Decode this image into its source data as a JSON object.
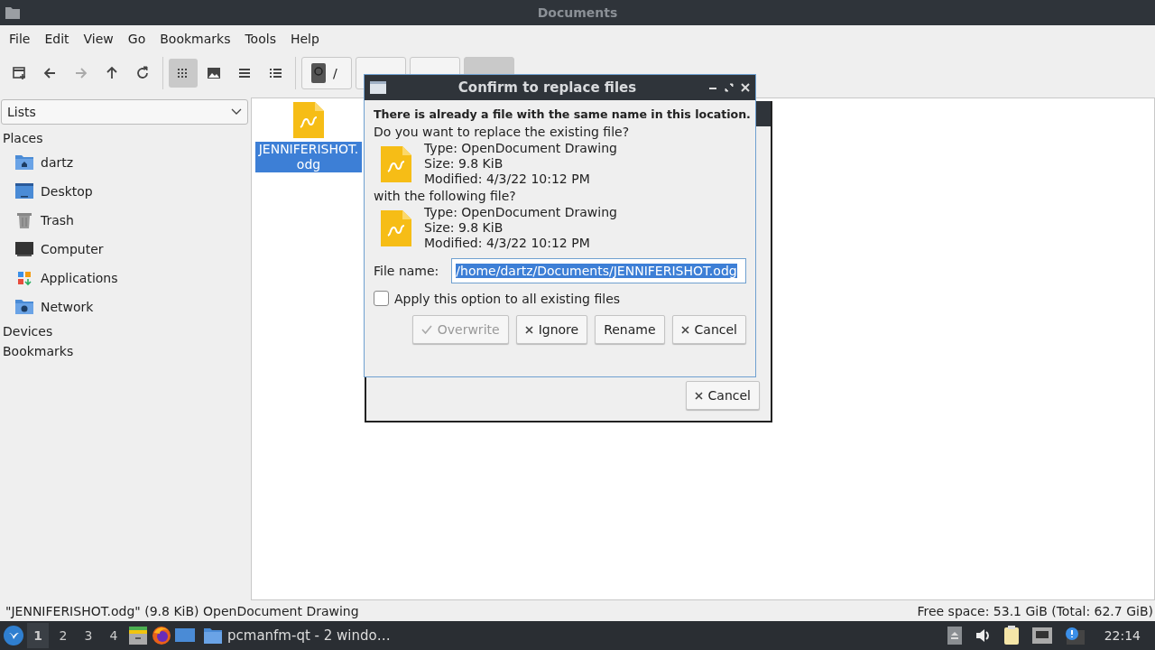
{
  "window": {
    "title": "Documents"
  },
  "menu": [
    "File",
    "Edit",
    "View",
    "Go",
    "Bookmarks",
    "Tools",
    "Help"
  ],
  "toolbar": [
    {
      "kind": "newtab",
      "disabled": false,
      "selected": false
    },
    {
      "kind": "back",
      "disabled": false,
      "selected": false
    },
    {
      "kind": "forward",
      "disabled": true,
      "selected": false
    },
    {
      "kind": "up",
      "disabled": false,
      "selected": false
    },
    {
      "kind": "reload",
      "disabled": false,
      "selected": false
    },
    {
      "kind": "sep"
    },
    {
      "kind": "icons",
      "disabled": false,
      "selected": true
    },
    {
      "kind": "thumbs",
      "disabled": false,
      "selected": false
    },
    {
      "kind": "compact",
      "disabled": false,
      "selected": false
    },
    {
      "kind": "details",
      "disabled": false,
      "selected": false
    },
    {
      "kind": "sep"
    }
  ],
  "path_crumbs": [
    {
      "kind": "root",
      "label": "/",
      "selected": false
    },
    {
      "kind": "folder",
      "selected": false
    },
    {
      "kind": "folder",
      "selected": false
    },
    {
      "kind": "folder",
      "selected": true
    }
  ],
  "sidebar": {
    "view_select": "Lists",
    "sections": [
      {
        "title": "Places",
        "items": [
          {
            "label": "dartz",
            "kind": "home"
          },
          {
            "label": "Desktop",
            "kind": "desktop"
          },
          {
            "label": "Trash",
            "kind": "trash"
          },
          {
            "label": "Computer",
            "kind": "computer"
          },
          {
            "label": "Applications",
            "kind": "apps"
          },
          {
            "label": "Network",
            "kind": "network"
          }
        ]
      },
      {
        "title": "Devices"
      },
      {
        "title": "Bookmarks"
      }
    ]
  },
  "files": [
    {
      "name": "JENNIFERISHOT.odg",
      "selected": true
    }
  ],
  "progress_dialog": {
    "buttons": [
      {
        "label": "Cancel",
        "kind": "cancel",
        "disabled": false
      }
    ]
  },
  "replace_dialog": {
    "title": "Confirm to replace files",
    "heading": "There is already a file with the same name in this location.",
    "question_existing": "Do you want to replace the existing file?",
    "existing_file": {
      "type": "Type: OpenDocument Drawing",
      "size": "Size: 9.8 KiB",
      "modified": "Modified: 4/3/22 10:12 PM"
    },
    "question_new": "with the following file?",
    "new_file": {
      "type": "Type: OpenDocument Drawing",
      "size": "Size: 9.8 KiB",
      "modified": "Modified: 4/3/22 10:12 PM"
    },
    "file_name_label": "File name:",
    "file_name_value": "/home/dartz/Documents/JENNIFERISHOT.odg",
    "file_name_selected": true,
    "apply_all": {
      "label": "Apply this option to all existing files",
      "checked": false
    },
    "buttons": [
      {
        "label": "Overwrite",
        "kind": "confirm",
        "disabled": true
      },
      {
        "label": "Ignore",
        "kind": "cancel",
        "disabled": false
      },
      {
        "label": "Rename",
        "kind": "plain",
        "disabled": false
      },
      {
        "label": "Cancel",
        "kind": "cancel",
        "disabled": false
      }
    ]
  },
  "status_bar": {
    "left": "\"JENNIFERISHOT.odg\" (9.8 KiB) OpenDocument Drawing",
    "right": "Free space: 53.1 GiB (Total: 62.7 GiB)"
  },
  "taskbar": {
    "workspaces": [
      {
        "label": "1",
        "selected": true
      },
      {
        "label": "2",
        "selected": false
      },
      {
        "label": "3",
        "selected": false
      },
      {
        "label": "4",
        "selected": false
      }
    ],
    "task": "pcmanfm-qt - 2 windo…",
    "clock": "22:14"
  }
}
